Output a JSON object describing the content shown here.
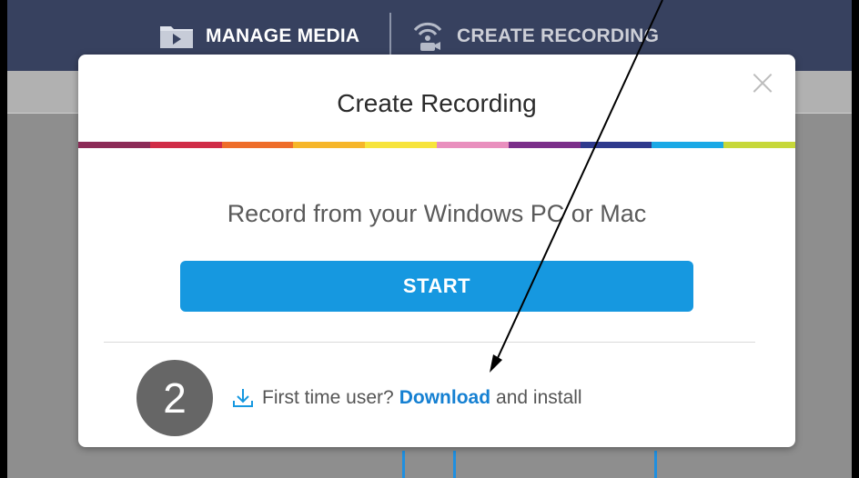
{
  "topbar": {
    "manage_label": "MANAGE MEDIA",
    "create_label": "CREATE RECORDING"
  },
  "modal": {
    "title": "Create Recording",
    "close_label": "×",
    "subtitle": "Record from your Windows PC or Mac",
    "start_label": "START",
    "footer_prefix": "First time user?",
    "footer_link": "Download",
    "footer_suffix": "and install"
  },
  "annotation": {
    "step_number": "2"
  },
  "colors": {
    "topbar": "#37415f",
    "accent": "#1698e0",
    "link": "#1580d2",
    "rainbow": [
      "#8c2b57",
      "#d02c47",
      "#ee6d2a",
      "#f6b62a",
      "#f7e43c",
      "#e98fbe",
      "#7b2f8a",
      "#2f3a8d",
      "#1aa9e6",
      "#c7d83a"
    ]
  },
  "icons": {
    "manage": "media-folder-icon",
    "create": "webcam-icon",
    "close": "close-icon",
    "download": "download-icon"
  }
}
